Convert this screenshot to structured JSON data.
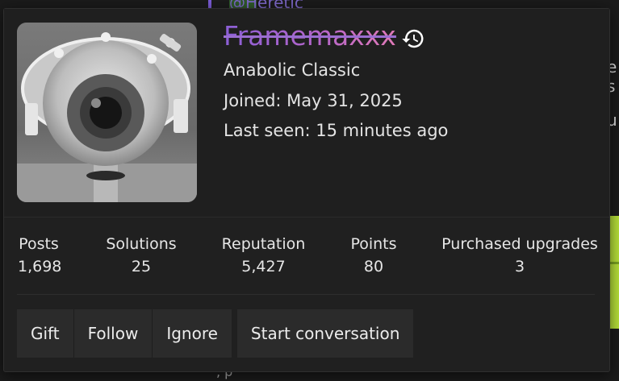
{
  "background": {
    "mention_text": "@Heretic",
    "right_fragment_1": "e s",
    "right_fragment_2": "u",
    "bottom_fragment": ", p"
  },
  "profile": {
    "username": "Framemaxxx",
    "username_gradient": [
      "#8b5fd6",
      "#b465c9",
      "#e07ab8"
    ],
    "history_icon": "history-clock-icon",
    "user_title": "Anabolic Classic",
    "joined": "Joined: May 31, 2025",
    "last_seen": "Last seen: 15 minutes ago"
  },
  "stats": [
    {
      "label": "Posts",
      "value": "1,698"
    },
    {
      "label": "Solutions",
      "value": "25"
    },
    {
      "label": "Reputation",
      "value": "5,427"
    },
    {
      "label": "Points",
      "value": "80"
    },
    {
      "label": "Purchased upgrades",
      "value": "3"
    }
  ],
  "actions": {
    "gift": "Gift",
    "follow": "Follow",
    "ignore": "Ignore",
    "start_conversation": "Start conversation"
  },
  "colors": {
    "card_bg": "#202020",
    "button_bg": "#2b2b2b",
    "accent_lime": "#b8e23a"
  }
}
